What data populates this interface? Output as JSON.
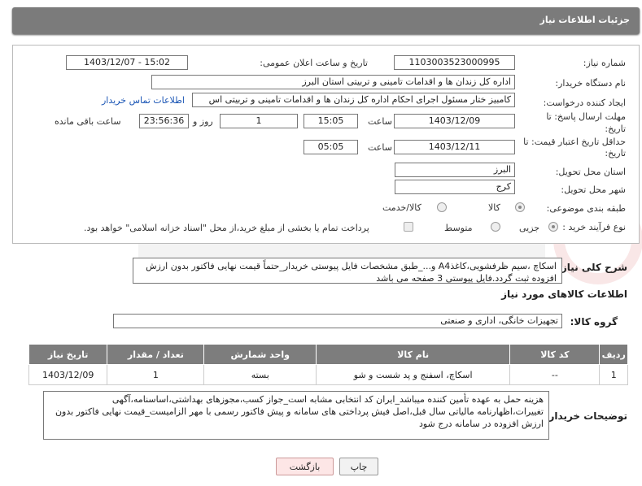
{
  "header": {
    "title": "جزئیات اطلاعات نیاز"
  },
  "form": {
    "need_number_label": "شماره نیاز:",
    "need_number": "1103003523000995",
    "announce_label": "تاریخ و ساعت اعلان عمومی:",
    "announce_value": "1403/12/07 - 15:02",
    "buyer_org_label": "نام دستگاه خریدار:",
    "buyer_org": "اداره کل زندان ها و اقدامات تامینی و تربیتی استان البرز",
    "requester_label": "ایجاد کننده درخواست:",
    "requester": "کامبیز ختار مسئول اجرای احکام اداره کل زندان ها و اقدامات تامینی و تربیتی اس",
    "contact_link": "اطلاعات تماس خریدار",
    "deadline_label": "مهلت ارسال پاسخ: تا",
    "deadline_label2": "تاریخ:",
    "deadline_date": "1403/12/09",
    "time_label": "ساعت",
    "deadline_time": "15:05",
    "days": "1",
    "days_label": "روز و",
    "remaining": "23:56:36",
    "remaining_label": "ساعت باقی مانده",
    "validity_label": "حداقل تاریخ اعتبار قیمت: تا",
    "validity_label2": "تاریخ:",
    "validity_date": "1403/12/11",
    "validity_time": "05:05",
    "province_label": "استان محل تحویل:",
    "province": "البرز",
    "city_label": "شهر محل تحویل:",
    "city": "کرج",
    "category_label": "طبقه بندی موضوعی:",
    "category_goods": "کالا",
    "category_service": "کالا/خدمت",
    "process_label": "نوع فرآیند خرید :",
    "process_small": "جزیی",
    "process_medium": "متوسط",
    "payment_note": "پرداخت تمام یا بخشی از مبلغ خرید،از محل \"اسناد خزانه اسلامی\" خواهد بود."
  },
  "summary": {
    "label": "شرح کلی نیاز:",
    "text": "اسکاچ ،سیم ظرفشویی،کاغذA4 و..._طبق مشخصات فایل پیوستی خریدار_حتماً قیمت نهایی فاکتور بدون ارزش افزوده ثبت گردد.فایل پیوستی 3 صفحه می باشد"
  },
  "goods_info": {
    "title": "اطلاعات کالاهای مورد نیاز",
    "group_label": "گروه کالا:",
    "group_value": "تجهیزات خانگی، اداری و صنعتی"
  },
  "table": {
    "headers": [
      "ردیف",
      "کد کالا",
      "نام کالا",
      "واحد شمارش",
      "تعداد / مقدار",
      "تاریخ نیاز"
    ],
    "rows": [
      [
        "1",
        "--",
        "اسکاچ، اسفنج و پد شست و شو",
        "بسته",
        "1",
        "1403/12/09"
      ]
    ]
  },
  "buyer_notes": {
    "label": "توضیحات خریدار:",
    "text": "هزینه حمل به عهده تأمین کننده میباشد_ایران کد انتخابی مشابه است_جواز کسب،مجوزهای بهداشتی،اساسنامه،آگهی تغییرات،اظهارنامه مالیاتی سال قبل،اصل فیش پرداختی های سامانه و پیش فاکتور رسمی با مهر الزامیست_قیمت نهایی فاکتور بدون ارزش افزوده در سامانه درج شود"
  },
  "buttons": {
    "print": "چاپ",
    "back": "بازگشت"
  },
  "colors": {
    "header_bg": "#7b7b7b",
    "link": "#1a55b5"
  }
}
